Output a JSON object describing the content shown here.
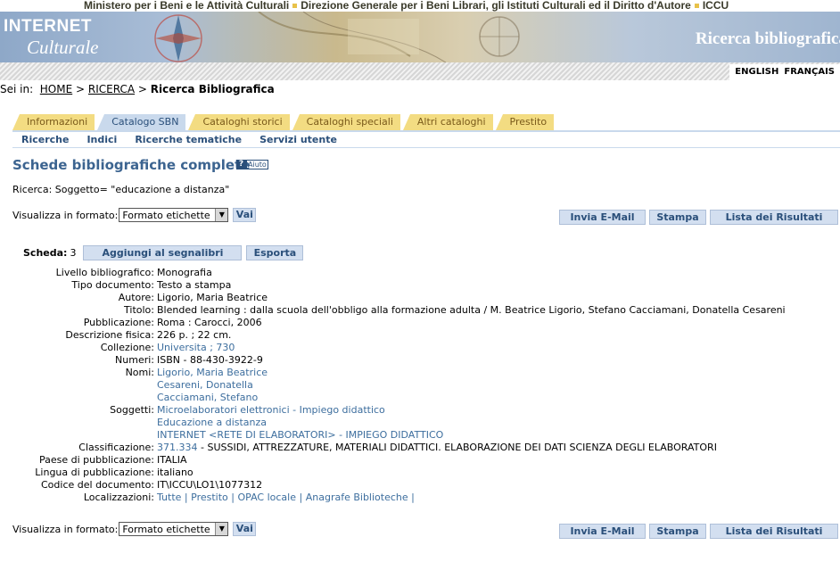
{
  "topbar": {
    "parts": [
      "Ministero per i Beni e le Attività Culturali",
      "Direzione Generale per i Beni Librari, gli Istituti Culturali ed il Diritto d'Autore",
      "ICCU"
    ]
  },
  "banner": {
    "logo_line1": "INTERNET",
    "logo_line2": "Culturale",
    "title": "Ricerca bibliografica"
  },
  "languages": [
    "ENGLISH",
    "FRANÇAIS"
  ],
  "breadcrumb": {
    "prefix": "Sei in:",
    "home": "HOME",
    "sep1": ">",
    "ricerca": "RICERCA",
    "sep2": ">",
    "current": "Ricerca Bibliografica"
  },
  "tabs": [
    {
      "label": "Informazioni",
      "active": false
    },
    {
      "label": "Catalogo SBN",
      "active": true
    },
    {
      "label": "Cataloghi storici",
      "active": false
    },
    {
      "label": "Cataloghi speciali",
      "active": false
    },
    {
      "label": "Altri cataloghi",
      "active": false
    },
    {
      "label": "Prestito",
      "active": false
    }
  ],
  "subnav": [
    "Ricerche",
    "Indici",
    "Ricerche tematiche",
    "Servizi utente"
  ],
  "page_title": "Schede bibliografiche complete",
  "help_label": "Aiuto",
  "search_line": "Ricerca: Soggetto= \"educazione a distanza\"",
  "format": {
    "label": "Visualizza in formato:",
    "selected": "Formato etichette",
    "go": "Vai"
  },
  "actions": {
    "email": "Invia E-Mail",
    "print": "Stampa",
    "results": "Lista dei Risultati"
  },
  "scheda": {
    "label": "Scheda:",
    "number": "3",
    "bookmark": "Aggiungi al segnalibri",
    "export": "Esporta"
  },
  "record": {
    "livello_label": "Livello bibliografico:",
    "livello": "Monografia",
    "tipo_label": "Tipo documento:",
    "tipo": "Testo a stampa",
    "autore_label": "Autore:",
    "autore": "Ligorio, Maria Beatrice",
    "titolo_label": "Titolo:",
    "titolo": "Blended learning : dalla scuola dell'obbligo alla formazione adulta / M. Beatrice Ligorio, Stefano Cacciamani, Donatella Cesareni",
    "pubblicazione_label": "Pubblicazione:",
    "pubblicazione": "Roma : Carocci, 2006",
    "descrizione_label": "Descrizione fisica:",
    "descrizione": "226 p. ; 22 cm.",
    "collezione_label": "Collezione:",
    "collezione": "Universita ; 730",
    "numeri_label": "Numeri:",
    "numeri": "ISBN - 88-430-3922-9",
    "nomi_label": "Nomi:",
    "nomi": [
      "Ligorio, Maria Beatrice",
      "Cesareni, Donatella",
      "Cacciamani, Stefano"
    ],
    "soggetti_label": "Soggetti:",
    "soggetti": [
      "Microelaboratori elettronici - Impiego didattico",
      "Educazione a distanza",
      "INTERNET <RETE DI ELABORATORI> - IMPIEGO DIDATTICO"
    ],
    "classificazione_label": "Classificazione:",
    "classificazione_code": "371.334",
    "classificazione_text": "- SUSSIDI, ATTREZZATURE, MATERIALI DIDATTICI. ELABORAZIONE DEI DATI SCIENZA DEGLI ELABORATORI",
    "paese_label": "Paese di pubblicazione:",
    "paese": "ITALIA",
    "lingua_label": "Lingua di pubblicazione:",
    "lingua": "italiano",
    "codice_label": "Codice del documento:",
    "codice": "IT\\ICCU\\LO1\\1077312",
    "localizzazioni_label": "Localizzazioni:",
    "localizzazioni": [
      "Tutte",
      "Prestito",
      "OPAC locale",
      "Anagrafe Biblioteche"
    ],
    "loc_sep": "|"
  },
  "colors": {
    "tab_inactive": "#f3dc82",
    "tab_active": "#c9d9ec",
    "link": "#3d6e9e",
    "title": "#3c6490",
    "button_bg": "#d3dff0"
  }
}
